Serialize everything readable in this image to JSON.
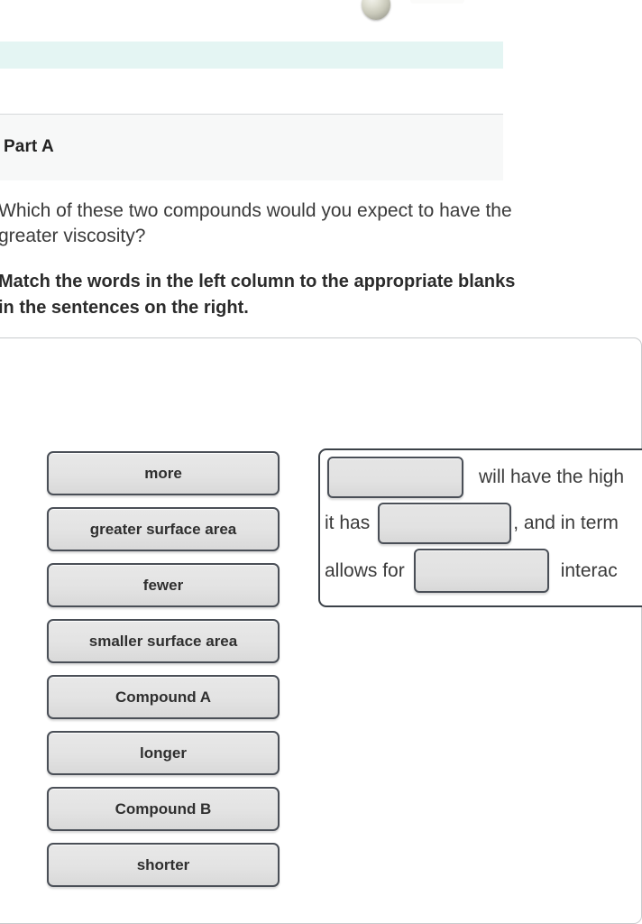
{
  "molecule": {
    "atom_icon": "sphere-atom-gray",
    "description": "partially visible ball-and-stick molecular model"
  },
  "banner": {
    "accent_color": "#e4f5f3"
  },
  "part": {
    "title": "Part A"
  },
  "question": {
    "prompt": "Which of these two compounds would you expect to have the greater viscosity?",
    "instruction": "Match the words in the left column to the appropriate blanks in the sentences on the right."
  },
  "word_bank": {
    "tiles": [
      {
        "label": "more"
      },
      {
        "label": "greater surface area"
      },
      {
        "label": "fewer"
      },
      {
        "label": "smaller surface area"
      },
      {
        "label": "Compound A"
      },
      {
        "label": "longer"
      },
      {
        "label": "Compound B"
      },
      {
        "label": "shorter"
      }
    ]
  },
  "sentences": {
    "line_1": {
      "blank_value": "",
      "text_after": "will have the high"
    },
    "line_2": {
      "text_before": "it has",
      "blank_value": "",
      "text_after": ", and in term"
    },
    "line_3": {
      "text_before": "allows for",
      "blank_value": "",
      "text_after": "interac"
    }
  },
  "colors": {
    "tile_border": "#4a4f57",
    "tile_fill": "#e3e3e3",
    "panel_border": "#3b4148",
    "header_bg": "#f7f8f8"
  }
}
